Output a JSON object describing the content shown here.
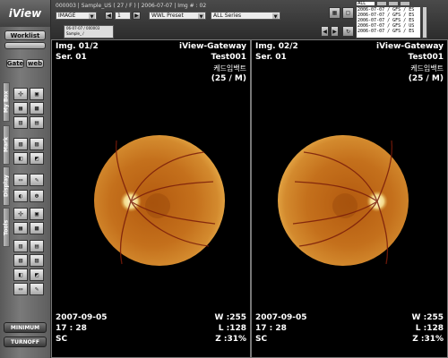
{
  "app": {
    "logo": "iView"
  },
  "sidebar": {
    "worklist_label": "Worklist",
    "gate_label": "Gate",
    "web_label": "web",
    "tabs": [
      "My Box",
      "Mark",
      "Display",
      "Tools"
    ],
    "minimum_label": "MINIMUM",
    "turnoff_label": "TURNOFF"
  },
  "header": {
    "patient_info": "000003  |  Sample_US ( 27 / F )  |  2006-07-07  |  Img # : 02",
    "modality_select": "IMAGE",
    "image_index": "1",
    "preset_select": "WWL Preset",
    "series_select": "ALL Series",
    "tab_all": "ALL",
    "study_tab_line1": "06-07-07 / 000003",
    "study_tab_line2": "Sample_ /",
    "series_list": [
      "2006-07-07 / GFS      / ES",
      "2006-07-07 / GFS      / ES",
      "2006-07-07 / GFS      / ES",
      "2006-07-07 / GFS      / US",
      "2006-07-07 / GFS      / ES"
    ]
  },
  "viewports": [
    {
      "img": "Img. 01/2",
      "ser": "Ser. 01",
      "institution": "iView-Gateway",
      "patient_id": "Test001",
      "patient_name": "케드임백트",
      "age_sex": "(25 / M)",
      "date": "2007-09-05",
      "time": "17 : 28",
      "modality": "SC",
      "window": "W :255",
      "level": "L :128",
      "zoom": "Z :31%"
    },
    {
      "img": "Img. 02/2",
      "ser": "Ser. 01",
      "institution": "iView-Gateway",
      "patient_id": "Test001",
      "patient_name": "케드임백트",
      "age_sex": "(25 / M)",
      "date": "2007-09-05",
      "time": "17 : 28",
      "modality": "SC",
      "window": "W :255",
      "level": "L :128",
      "zoom": "Z :31%"
    }
  ],
  "icons": [
    "grid-layout-icon",
    "single-layout-icon",
    "prev-icon",
    "next-icon",
    "fundus-image-left",
    "fundus-image-right"
  ]
}
